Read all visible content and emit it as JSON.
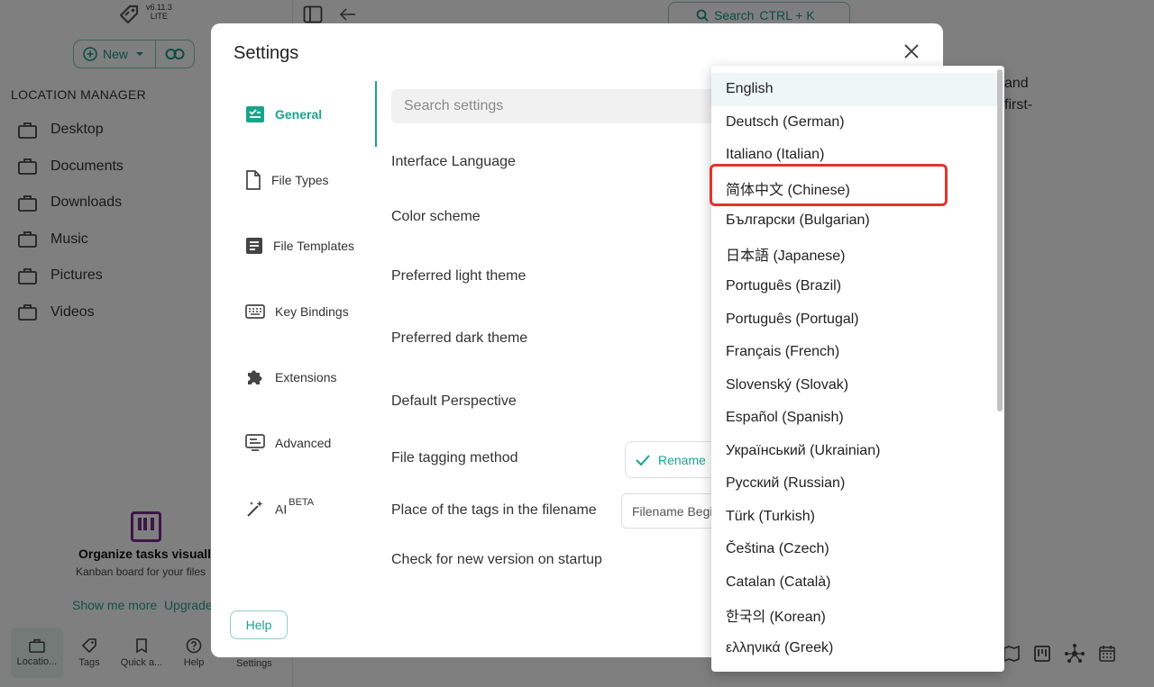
{
  "app": {
    "version": "v6.11.3",
    "edition": "LITE",
    "new_label": "New",
    "location_manager_title": "LOCATION MANAGER",
    "locations": [
      "Desktop",
      "Documents",
      "Downloads",
      "Music",
      "Pictures",
      "Videos"
    ],
    "search_label": "Search",
    "search_shortcut": "CTRL + K",
    "main_text_lines": [
      "and",
      "first-"
    ],
    "promo": {
      "title": "Organize tasks visually",
      "subtitle": "Kanban board for your files",
      "show_more": "Show me more",
      "upgrade": "Upgrade"
    },
    "bottom_nav": [
      {
        "label": "Locatio...",
        "icon": "briefcase-icon"
      },
      {
        "label": "Tags",
        "icon": "tag-icon"
      },
      {
        "label": "Quick a...",
        "icon": "bookmark-icon"
      },
      {
        "label": "Help",
        "icon": "help-icon"
      }
    ],
    "settings_label": "Settings"
  },
  "settings": {
    "title": "Settings",
    "search_placeholder": "Search settings",
    "tabs": [
      {
        "label": "General",
        "icon": "general-check-icon"
      },
      {
        "label": "File Types",
        "icon": "file-icon"
      },
      {
        "label": "File Templates",
        "icon": "file-template-icon"
      },
      {
        "label": "Key Bindings",
        "icon": "keyboard-icon"
      },
      {
        "label": "Extensions",
        "icon": "puzzle-icon"
      },
      {
        "label": "Advanced",
        "icon": "advanced-icon"
      },
      {
        "label": "AI",
        "badge": "BETA",
        "icon": "magic-wand-icon"
      }
    ],
    "rows": {
      "interface_language": "Interface Language",
      "color_scheme": "Color scheme",
      "light_theme": "Preferred light theme",
      "dark_theme": "Preferred dark theme",
      "perspective": "Default Perspective",
      "tagging_method": "File tagging method",
      "tags_place": "Place of the tags in the filename",
      "check_version": "Check for new version on startup"
    },
    "tagging_value": "Rename",
    "tags_place_value": "Filename Beginning",
    "help_label": "Help"
  },
  "language_dropdown": {
    "selected": "English",
    "options": [
      "English",
      "Deutsch (German)",
      "Italiano (Italian)",
      "简体中文 (Chinese)",
      "Български (Bulgarian)",
      "日本語 (Japanese)",
      "Português (Brazil)",
      "Português (Portugal)",
      "Français (French)",
      "Slovenský (Slovak)",
      "Español (Spanish)",
      "Український (Ukrainian)",
      "Русский (Russian)",
      "Türk (Turkish)",
      "Čeština (Czech)",
      "Catalan (Català)",
      "한국의 (Korean)",
      "ελληνικά (Greek)"
    ]
  },
  "colors": {
    "accent": "#1aa38c",
    "highlight": "#e0352b",
    "overlay": "rgba(0,0,0,0.5)"
  }
}
